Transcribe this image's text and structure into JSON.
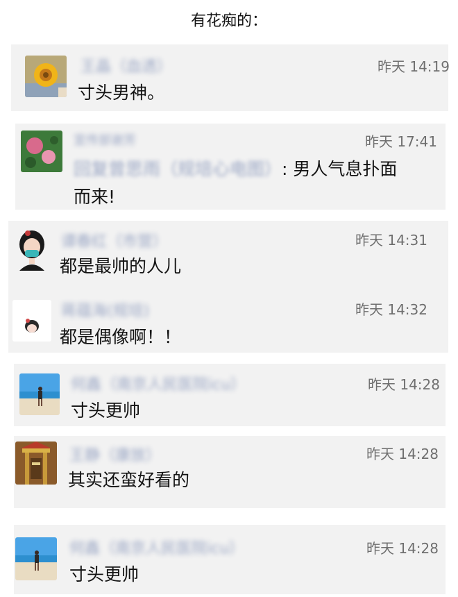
{
  "heading": "有花痴的：",
  "comments": [
    {
      "avatar_icon": "sunflower-avatar-icon",
      "name": "王晶（血透）",
      "time": "昨天 14:19",
      "message": "寸头男神。"
    },
    {
      "avatar_icon": "flower-avatar-icon",
      "name": "宣传部谢芳",
      "time": "昨天 17:41",
      "reply_prefix": "回复",
      "reply_to": "曾思雨（规培心电图）",
      "message_line1": ": 男人气息扑面",
      "message_line2": "而来!"
    },
    {
      "avatar_icon": "cartoon-girl-avatar-icon",
      "name": "谭春红（市营）",
      "time": "昨天 14:31",
      "message": "都是最帅的人儿"
    },
    {
      "avatar_icon": "doll-avatar-icon",
      "name": "蒋蕴海(规培)",
      "time": "昨天 14:32",
      "message": "都是偶像啊！！"
    },
    {
      "avatar_icon": "beach-person-avatar-icon",
      "name": "何鑫（南京人民医院icu）",
      "time": "昨天 14:28",
      "message": "寸头更帅"
    },
    {
      "avatar_icon": "temple-avatar-icon",
      "name": "王静（康放）",
      "time": "昨天 14:28",
      "message": "其实还蛮好看的"
    },
    {
      "avatar_icon": "beach-person-avatar-icon",
      "name": "何鑫（南京人民医院icu）",
      "time": "昨天 14:28",
      "message": "寸头更帅"
    }
  ]
}
